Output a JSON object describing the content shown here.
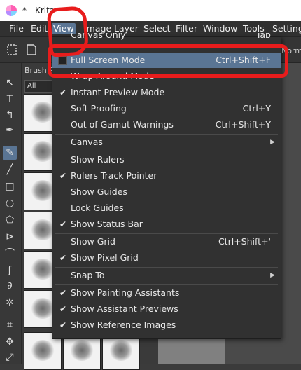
{
  "window": {
    "title": "* - Krita"
  },
  "menubar": {
    "items": [
      "File",
      "Edit",
      "View",
      "Image",
      "Layer",
      "Select",
      "Filter",
      "Window",
      "Tools",
      "Settings"
    ]
  },
  "toolbar": {
    "blend_mode_partial": "Norm"
  },
  "docker": {
    "title": "Brush Pr",
    "filter": "All"
  },
  "view_menu": {
    "partial_top_label": "Canvas Only",
    "partial_top_shortcut": "Tab",
    "items": [
      {
        "label": "Full Screen Mode",
        "shortcut": "Ctrl+Shift+F",
        "checkable": true,
        "checked": false,
        "highlighted": true
      },
      {
        "label": "Wrap Around Mode",
        "shortcut": "",
        "checkable": false,
        "checked": false
      },
      {
        "label": "Instant Preview Mode",
        "shortcut": "",
        "checkable": true,
        "checked": true
      },
      {
        "label": "Soft Proofing",
        "shortcut": "Ctrl+Y",
        "checkable": false,
        "checked": false
      },
      {
        "label": "Out of Gamut Warnings",
        "shortcut": "Ctrl+Shift+Y",
        "checkable": false,
        "checked": false
      },
      {
        "label": "Canvas",
        "shortcut": "",
        "submenu": true
      },
      {
        "label": "Show Rulers",
        "shortcut": "",
        "checkable": false,
        "checked": false
      },
      {
        "label": "Rulers Track Pointer",
        "shortcut": "",
        "checkable": true,
        "checked": true
      },
      {
        "label": "Show Guides",
        "shortcut": "",
        "checkable": false,
        "checked": false
      },
      {
        "label": "Lock Guides",
        "shortcut": "",
        "checkable": false,
        "checked": false
      },
      {
        "label": "Show Status Bar",
        "shortcut": "",
        "checkable": true,
        "checked": true
      },
      {
        "label": "Show Grid",
        "shortcut": "Ctrl+Shift+'",
        "checkable": false,
        "checked": false
      },
      {
        "label": "Show Pixel Grid",
        "shortcut": "",
        "checkable": true,
        "checked": true
      },
      {
        "label": "Snap To",
        "shortcut": "",
        "submenu": true
      },
      {
        "label": "Show Painting Assistants",
        "shortcut": "",
        "checkable": true,
        "checked": true
      },
      {
        "label": "Show Assistant Previews",
        "shortcut": "",
        "checkable": true,
        "checked": true
      },
      {
        "label": "Show Reference Images",
        "shortcut": "",
        "checkable": true,
        "checked": true
      }
    ]
  },
  "colors": {
    "highlight": "#5a7594",
    "annotation": "#e81c1c",
    "menu_bg": "#313131"
  }
}
